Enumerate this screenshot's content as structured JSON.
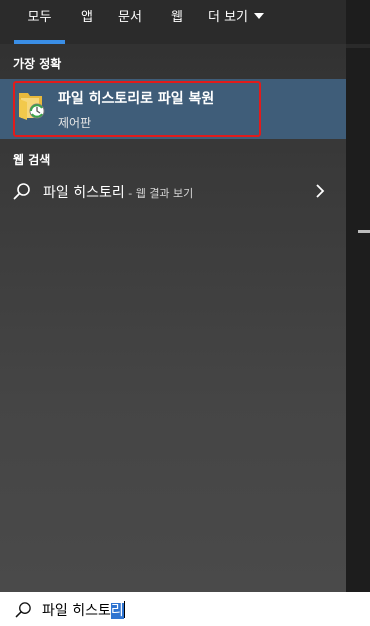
{
  "tabs": [
    {
      "label": "모두",
      "active": true
    },
    {
      "label": "앱"
    },
    {
      "label": "문서"
    },
    {
      "label": "웹"
    },
    {
      "label": "더 보기"
    }
  ],
  "best_match": {
    "heading": "가장 정확",
    "name": "파일 히스토리로 파일 복원",
    "subtitle": "제어판",
    "icon": "folder-history-icon"
  },
  "web_search": {
    "heading": "웹 검색",
    "query": "파일 히스토리",
    "suffix": " - 웹 결과 보기",
    "icon": "search-icon"
  },
  "search_box": {
    "typed": "파일 히스토",
    "selected": "리"
  },
  "colors": {
    "accent": "#3a8ee6",
    "selected_row": "#3f5d79",
    "highlight_border": "#e21b1b"
  }
}
